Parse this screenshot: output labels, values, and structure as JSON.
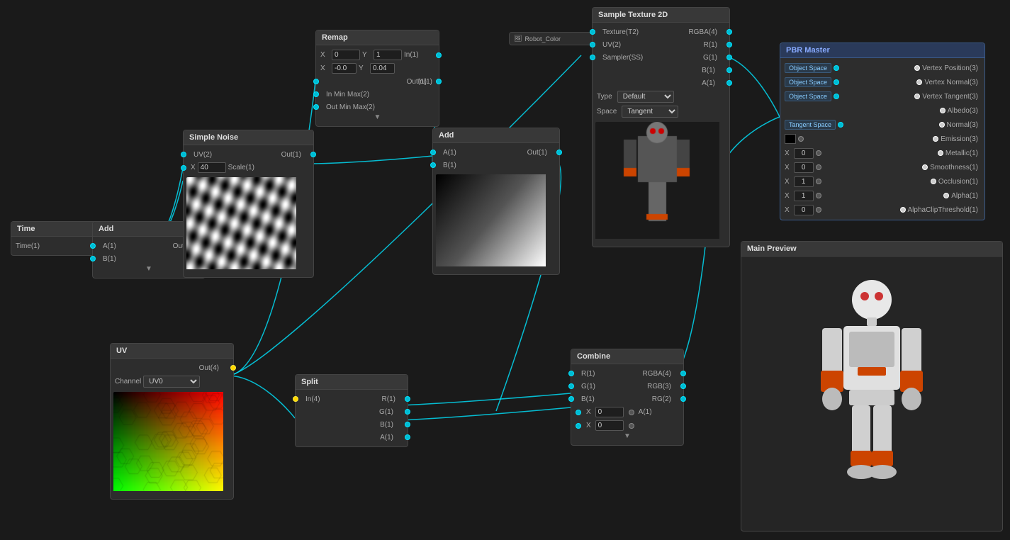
{
  "nodes": {
    "time": {
      "title": "Time",
      "outputs": [
        {
          "label": "Time(1)"
        }
      ]
    },
    "add_left": {
      "title": "Add",
      "inputs": [
        {
          "label": "A(1)"
        },
        {
          "label": "B(1)"
        }
      ],
      "outputs": [
        {
          "label": "Out(1)"
        }
      ]
    },
    "simple_noise": {
      "title": "Simple Noise",
      "inputs": [
        {
          "label": "UV(2)"
        },
        {
          "label": "Scale(1)"
        }
      ],
      "outputs": [
        {
          "label": "Out(1)"
        }
      ],
      "scale_value": "40"
    },
    "uv": {
      "title": "UV",
      "outputs": [
        {
          "label": "Out(4)"
        }
      ],
      "channel_label": "Channel",
      "channel_value": "UV0"
    },
    "remap": {
      "title": "Remap",
      "inputs": [
        {
          "label": "In(1)"
        },
        {
          "label": "In Min Max(2)"
        },
        {
          "label": "Out Min Max(2)"
        }
      ],
      "outputs": [
        {
          "label": "Out(1)"
        }
      ],
      "x_val": "0",
      "y_val": "1",
      "x2_val": "-0.0",
      "y2_val": "0.04"
    },
    "add_right": {
      "title": "Add",
      "inputs": [
        {
          "label": "A(1)"
        },
        {
          "label": "B(1)"
        }
      ],
      "outputs": [
        {
          "label": "Out(1)"
        }
      ]
    },
    "split": {
      "title": "Split",
      "inputs": [
        {
          "label": "In(4)"
        }
      ],
      "outputs": [
        {
          "label": "R(1)"
        },
        {
          "label": "G(1)"
        },
        {
          "label": "B(1)"
        },
        {
          "label": "A(1)"
        }
      ]
    },
    "combine": {
      "title": "Combine",
      "inputs": [
        {
          "label": "R(1)"
        },
        {
          "label": "G(1)"
        },
        {
          "label": "B(1)"
        },
        {
          "label": "A(1)"
        }
      ],
      "outputs": [
        {
          "label": "RGBA(4)"
        },
        {
          "label": "RGB(3)"
        },
        {
          "label": "RG(2)"
        }
      ],
      "x1_val": "0",
      "x2_val": "0"
    },
    "robot_color": {
      "title": "Robot_Color"
    },
    "sample_texture": {
      "title": "Sample Texture 2D",
      "inputs": [
        {
          "label": "Texture(T2)"
        },
        {
          "label": "UV(2)"
        },
        {
          "label": "Sampler(SS)"
        }
      ],
      "outputs": [
        {
          "label": "RGBA(4)"
        },
        {
          "label": "R(1)"
        },
        {
          "label": "G(1)"
        },
        {
          "label": "B(1)"
        },
        {
          "label": "A(1)"
        }
      ],
      "type_label": "Type",
      "type_value": "Default",
      "space_label": "Space",
      "space_value": "Tangent"
    },
    "pbr_master": {
      "title": "PBR Master",
      "rows": [
        {
          "left_label": "Object Space",
          "right_label": "Vertex Position(3)",
          "left_port": "cyan",
          "right_port": "white"
        },
        {
          "left_label": "Object Space",
          "right_label": "Vertex Normal(3)",
          "left_port": "cyan",
          "right_port": "white"
        },
        {
          "left_label": "Object Space",
          "right_label": "Vertex Tangent(3)",
          "left_port": "cyan",
          "right_port": "white"
        },
        {
          "left_label": "",
          "right_label": "Albedo(3)",
          "left_port": "none",
          "right_port": "white"
        },
        {
          "left_label": "Tangent Space",
          "right_label": "Normal(3)",
          "left_port": "cyan",
          "right_port": "white"
        },
        {
          "left_label": "emission",
          "right_label": "Emission(3)",
          "left_port": "swatch_black",
          "right_port": "dot_white"
        },
        {
          "left_label": "0",
          "right_label": "Metallic(1)",
          "left_port": "x_input",
          "right_port": "dot_white"
        },
        {
          "left_label": "0",
          "right_label": "Smoothness(1)",
          "left_port": "x_input",
          "right_port": "dot_white"
        },
        {
          "left_label": "1",
          "right_label": "Occlusion(1)",
          "left_port": "x_input",
          "right_port": "dot_white"
        },
        {
          "left_label": "1",
          "right_label": "Alpha(1)",
          "left_port": "x_input",
          "right_port": "dot_white"
        },
        {
          "left_label": "0",
          "right_label": "AlphaClipThreshold(1)",
          "left_port": "x_input",
          "right_port": "dot_white"
        }
      ]
    }
  },
  "main_preview": {
    "title": "Main Preview"
  },
  "colors": {
    "node_bg": "#2d2d2d",
    "node_header": "#383838",
    "port_cyan": "#00bcd4",
    "port_white": "#cccccc",
    "connection_line": "#00e5ff",
    "pbr_header": "#2a3a5a"
  }
}
